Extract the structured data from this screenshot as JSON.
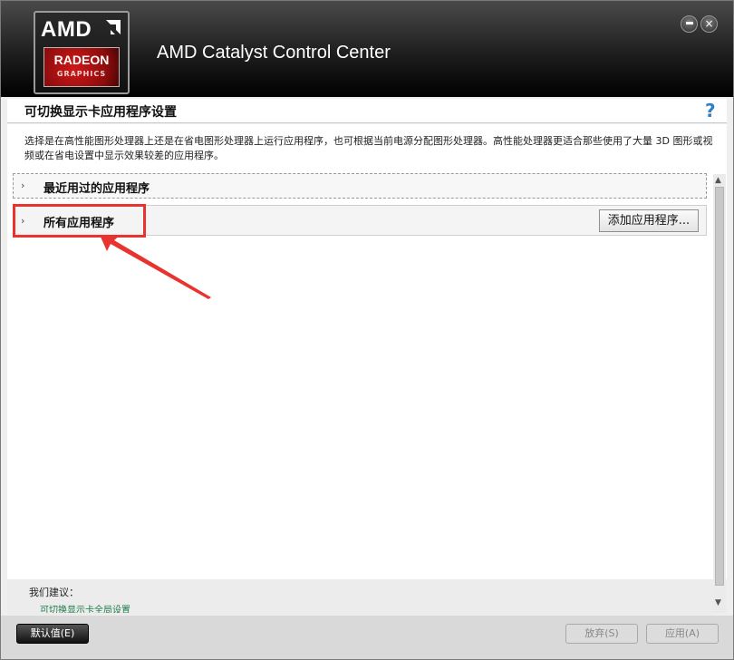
{
  "header": {
    "logo_amd": "AMD",
    "logo_radeon": "RADEON",
    "logo_graphics": "GRAPHICS",
    "title": "AMD Catalyst Control Center",
    "close_glyph": "×"
  },
  "page": {
    "title": "可切换显示卡应用程序设置",
    "help_glyph": "?",
    "description": "选择是在高性能图形处理器上还是在省电图形处理器上运行应用程序，也可根据当前电源分配图形处理器。高性能处理器更适合那些使用了大量 3D 图形或视频或在省电设置中显示效果较差的应用程序。"
  },
  "groups": {
    "recent": {
      "label": "最近用过的应用程序",
      "chevron": "›"
    },
    "all": {
      "label": "所有应用程序",
      "chevron": "›",
      "add_button": "添加应用程序..."
    }
  },
  "recommendation": {
    "title": "我们建议：",
    "link": "可切换显示卡全局设置"
  },
  "footer": {
    "default_button": "默认值(E)",
    "discard_button": "放弃(S)",
    "apply_button": "应用(A)"
  },
  "colors": {
    "annotation": "#e8332f",
    "brand_red": "#d01818",
    "help": "#2f7fc2"
  }
}
